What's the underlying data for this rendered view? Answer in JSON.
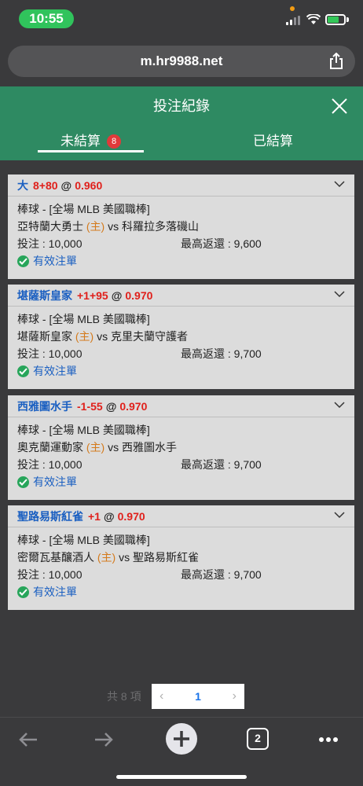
{
  "status": {
    "time": "10:55"
  },
  "browser": {
    "url": "m.hr9988.net",
    "tab_count": "2"
  },
  "header": {
    "title": "投注紀錄"
  },
  "tabs": {
    "unsettled": {
      "label": "未結算",
      "badge": "8"
    },
    "settled": {
      "label": "已結算"
    }
  },
  "labels": {
    "stake_prefix": "投注 : ",
    "max_return_prefix": "最高返還 : ",
    "home_tag": "(主)",
    "vs": "vs",
    "valid": "有效注單",
    "at": "@"
  },
  "bets": [
    {
      "selection": "大",
      "handicap": "8+80",
      "odds": "0.960",
      "league": "棒球 - [全場 MLB 美國職棒]",
      "home": "亞特蘭大勇士",
      "away": "科羅拉多落磯山",
      "stake": "10,000",
      "max_return": "9,600"
    },
    {
      "selection": "堪薩斯皇家",
      "handicap": "+1+95",
      "odds": "0.970",
      "league": "棒球 - [全場 MLB 美國職棒]",
      "home": "堪薩斯皇家",
      "away": "克里夫蘭守護者",
      "stake": "10,000",
      "max_return": "9,700"
    },
    {
      "selection": "西雅圖水手",
      "handicap": "-1-55",
      "odds": "0.970",
      "league": "棒球 - [全場 MLB 美國職棒]",
      "home": "奧克蘭運動家",
      "away": "西雅圖水手",
      "stake": "10,000",
      "max_return": "9,700"
    },
    {
      "selection": "聖路易斯紅雀",
      "handicap": "+1",
      "odds": "0.970",
      "league": "棒球 - [全場 MLB 美國職棒]",
      "home": "密爾瓦基釀酒人",
      "away": "聖路易斯紅雀",
      "stake": "10,000",
      "max_return": "9,700"
    }
  ],
  "pagination": {
    "total": "共 8 項",
    "prev": "‹",
    "current": "1",
    "next": "›"
  },
  "colors": {
    "header_green": "#2e8a62",
    "team_blue": "#1a5fc1",
    "odds_red": "#e0201b",
    "home_orange": "#d47a1c",
    "valid_green": "#27a55a"
  }
}
